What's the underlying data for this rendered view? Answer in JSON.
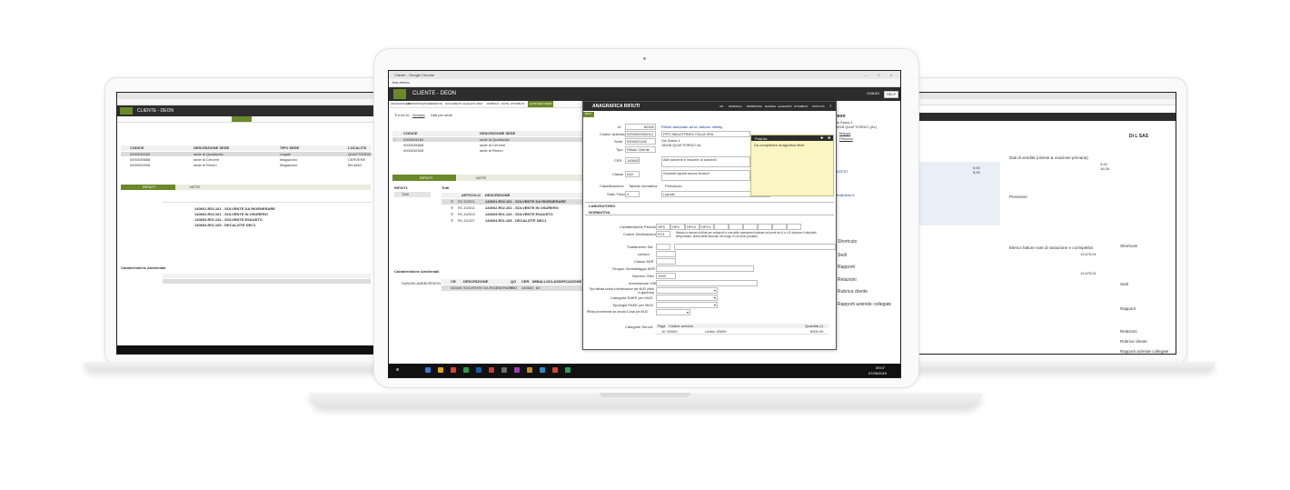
{
  "center": {
    "browser_title": "Cliente - Google Chrome",
    "address": "test-efecto",
    "app_title": "CLIENTE - DEON",
    "menu": [
      "ANAGRAFICHE",
      "AMMINISTRAZIONE",
      "VENDITE",
      "DOCUMENTI ALLEGATI",
      "CRM",
      "RUBRICA",
      "NOTE",
      "ATTRIBUTI",
      "ALTRI PER SEDE"
    ],
    "breadcrumb": [
      "Ti trovi in:",
      "Scheda",
      "Dati per sede"
    ],
    "sede_headers": [
      "CODICE",
      "DESCRIZIONE SEDE"
    ],
    "sedi": [
      {
        "code": "0000034160",
        "desc": "sede di Quattordio"
      },
      {
        "code": "0000035668",
        "desc": "sede di Cervere"
      },
      {
        "code": "0000032928",
        "desc": "sede di Rivero"
      }
    ],
    "tabs": [
      "RIFIUTI",
      "NOTE"
    ],
    "rifiuti_label": "RIFIUTI:",
    "tutti_label": "Tutti",
    "tutti_item": "Tutti",
    "rifiuti_headers": [
      "ARTICOLO",
      "DESCRIZIONE"
    ],
    "rifiuti": [
      {
        "code": "RC.D2001",
        "desc": "140601.R02.161 - SOLVENTE DA RIGENERARE"
      },
      {
        "code": "RC.D2002",
        "desc": "140602.R02.161 - SOLVENTE IN OSURERO"
      },
      {
        "code": "RC.D2003",
        "desc": "140603.R01.132 - SOLVENTE ESAUSTO"
      },
      {
        "code": "RC.D2107",
        "desc": "140604.R01.165 - DECALZITE DEC1"
      }
    ],
    "caratteristiche_label": "Caratteristiche Ambientali",
    "amb_headers": [
      "CR",
      "DESCRIZIONE",
      "QO",
      "CER",
      "IMBALLO",
      "CLASSIFICAZIONE"
    ],
    "amb_row": {
      "code": "DD445",
      "desc": "SOLVENTE DA RIGENERARE",
      "qo": "R02",
      "cer": "140602",
      "imb": "60"
    },
    "amb_file": "DANGELANEBORSION",
    "time": "09:07",
    "date": "07/06/2019"
  },
  "dialog": {
    "title": "ANAGRAFICA RIFIUTI",
    "toolbar": [
      "OK",
      "MODIFICA",
      "RIPRISTINA",
      "ELIMINA",
      "ALLEGATO",
      "ATTRIBUTI",
      "POST-ITS"
    ],
    "header_buttons": [
      "CHIUDI",
      "HELP"
    ],
    "sub_tab": "DATI",
    "fields": [
      {
        "label": "Id",
        "value": "60340"
      },
      {
        "label": "Codice azienda",
        "value": "0000000000012"
      },
      {
        "label": "Sede",
        "value": "0000021160"
      },
      {
        "label": "Tipo",
        "value": "Rifiuto Cliente"
      },
      {
        "label": "CER",
        "value": "140602"
      },
      {
        "label": "Classe",
        "value": "A02"
      },
      {
        "label": "Classificazione",
        "value": "Tabella normativa"
      },
      {
        "label": "Stato Fisico",
        "value": "4"
      }
    ],
    "link": "Rifiuto associato ad un articolo Infinity",
    "company": "PPG INDUSTRIES ITALIA SPA",
    "address1": "Via Sarna 1",
    "address2": "15028 QUATTORDIO AL",
    "cer_desc": "Altri solventi e miscele di solventi",
    "classe_desc": "Solventi liquidi senza fluoruri",
    "pericoloso": "Pericoloso",
    "stato_desc": "Liquido",
    "section_lab": "LABORATORIO",
    "section_norm": "NORMATIVA",
    "car_pericolo_label": "Caratteristiche Pericolo",
    "car_pericolo": [
      "HP3",
      "HP4",
      "HP10",
      "HP14"
    ],
    "codice_dest_label": "Codice Destinazione",
    "codice_dest": "R13",
    "codice_dest_desc": "Messa in riserva di rifiuti per sottoporli a una delle operazioni indicate nei punti da r1 a r12 (escluso il deposito temporaneo, prima della raccolta, nel luogo in cui sono prodotti)",
    "labels": [
      "Trattamento Std",
      "cortisol",
      "Classe ADR",
      "Gruppo d'imballaggio ADR",
      "Numero ONU",
      "Annotazione ONU",
      "Tipo attività svolta a destinazione per MUD (rifiuti in giacenza)",
      "Categoria RAEE per MUD",
      "Tipologia RAEE per MUD",
      "Rifiuto proveniente da circuito Conai per MUD"
    ],
    "numero_onu": "1993",
    "cat_label": "Categorie Servizi",
    "cat_headers": [
      "Riga",
      "Codice servizio",
      "Quantità (/)"
    ],
    "cat_row": {
      "riga": "10",
      "code": "S0000",
      "desc": "Livello 00000",
      "qty": "5000.00"
    },
    "postit_title": "Post-its",
    "postit_text": "Da completare anagrafica rifiuti"
  },
  "center_right": {
    "name": "Deon",
    "address": "Via Sarna 1",
    "city": "15028 QUATTORDIO (AL)",
    "links": [
      "Mappa",
      "Percorsi"
    ],
    "menu": [
      "Shortcuts",
      "Sedi",
      "Rapporti",
      "Relazioni",
      "Rubrica cliente",
      "Rapporti aziende collegate"
    ],
    "email": "info@deon.it",
    "phone": "0423757"
  },
  "left": {
    "app_title": "CLIENTE - DEON",
    "headers": [
      "CODICE",
      "DESCRIZIONE SEDE",
      "TIPO SEDE",
      "LOCALITÀ"
    ],
    "rows": [
      {
        "code": "0000034160",
        "desc": "sede di Quattordio",
        "tipo": "Legale",
        "loc": "QUATTORDIO"
      },
      {
        "code": "0000035668",
        "desc": "sede di Cervere",
        "tipo": "Magazzino",
        "loc": "CERVERE"
      },
      {
        "code": "0000032928",
        "desc": "sede di Rivero",
        "tipo": "Magazzino",
        "loc": "MILANO"
      }
    ],
    "tabs": [
      "RIFIUTI",
      "NOTE"
    ],
    "rifiuti": [
      "140601.R02.161 - SOLVENTE DA RIGENERARE",
      "140602.R02.161 - SOLVENTE IN OSURERO",
      "140603.R01.132 - SOLVENTE ESAUSTO",
      "140604.R01.165 - DECALZITE DEC1"
    ],
    "caratteristiche_label": "Caratteristiche Ambientali"
  },
  "right": {
    "sections": [
      "Dati di vendita (cliente & ovazione primaria)",
      "Previsioni",
      "Elenco fatture note di variazione e corrispettivi"
    ],
    "side_items": [
      "Shortcuts",
      "Sedi",
      "Rapporti",
      "Relazioni",
      "Rubrica cliente",
      "Rapporti aziende collegate"
    ],
    "values": [
      "3,00",
      "16,06",
      "0,00",
      "5,00",
      "0,00",
      "13.675,61",
      "13.675,61"
    ],
    "title": "Di L SAS"
  },
  "colors": {
    "app_green": "#6a8a2a",
    "dark_header": "#2d2d2d",
    "taskbar": "#111111",
    "postit": "#fbf5c3"
  }
}
